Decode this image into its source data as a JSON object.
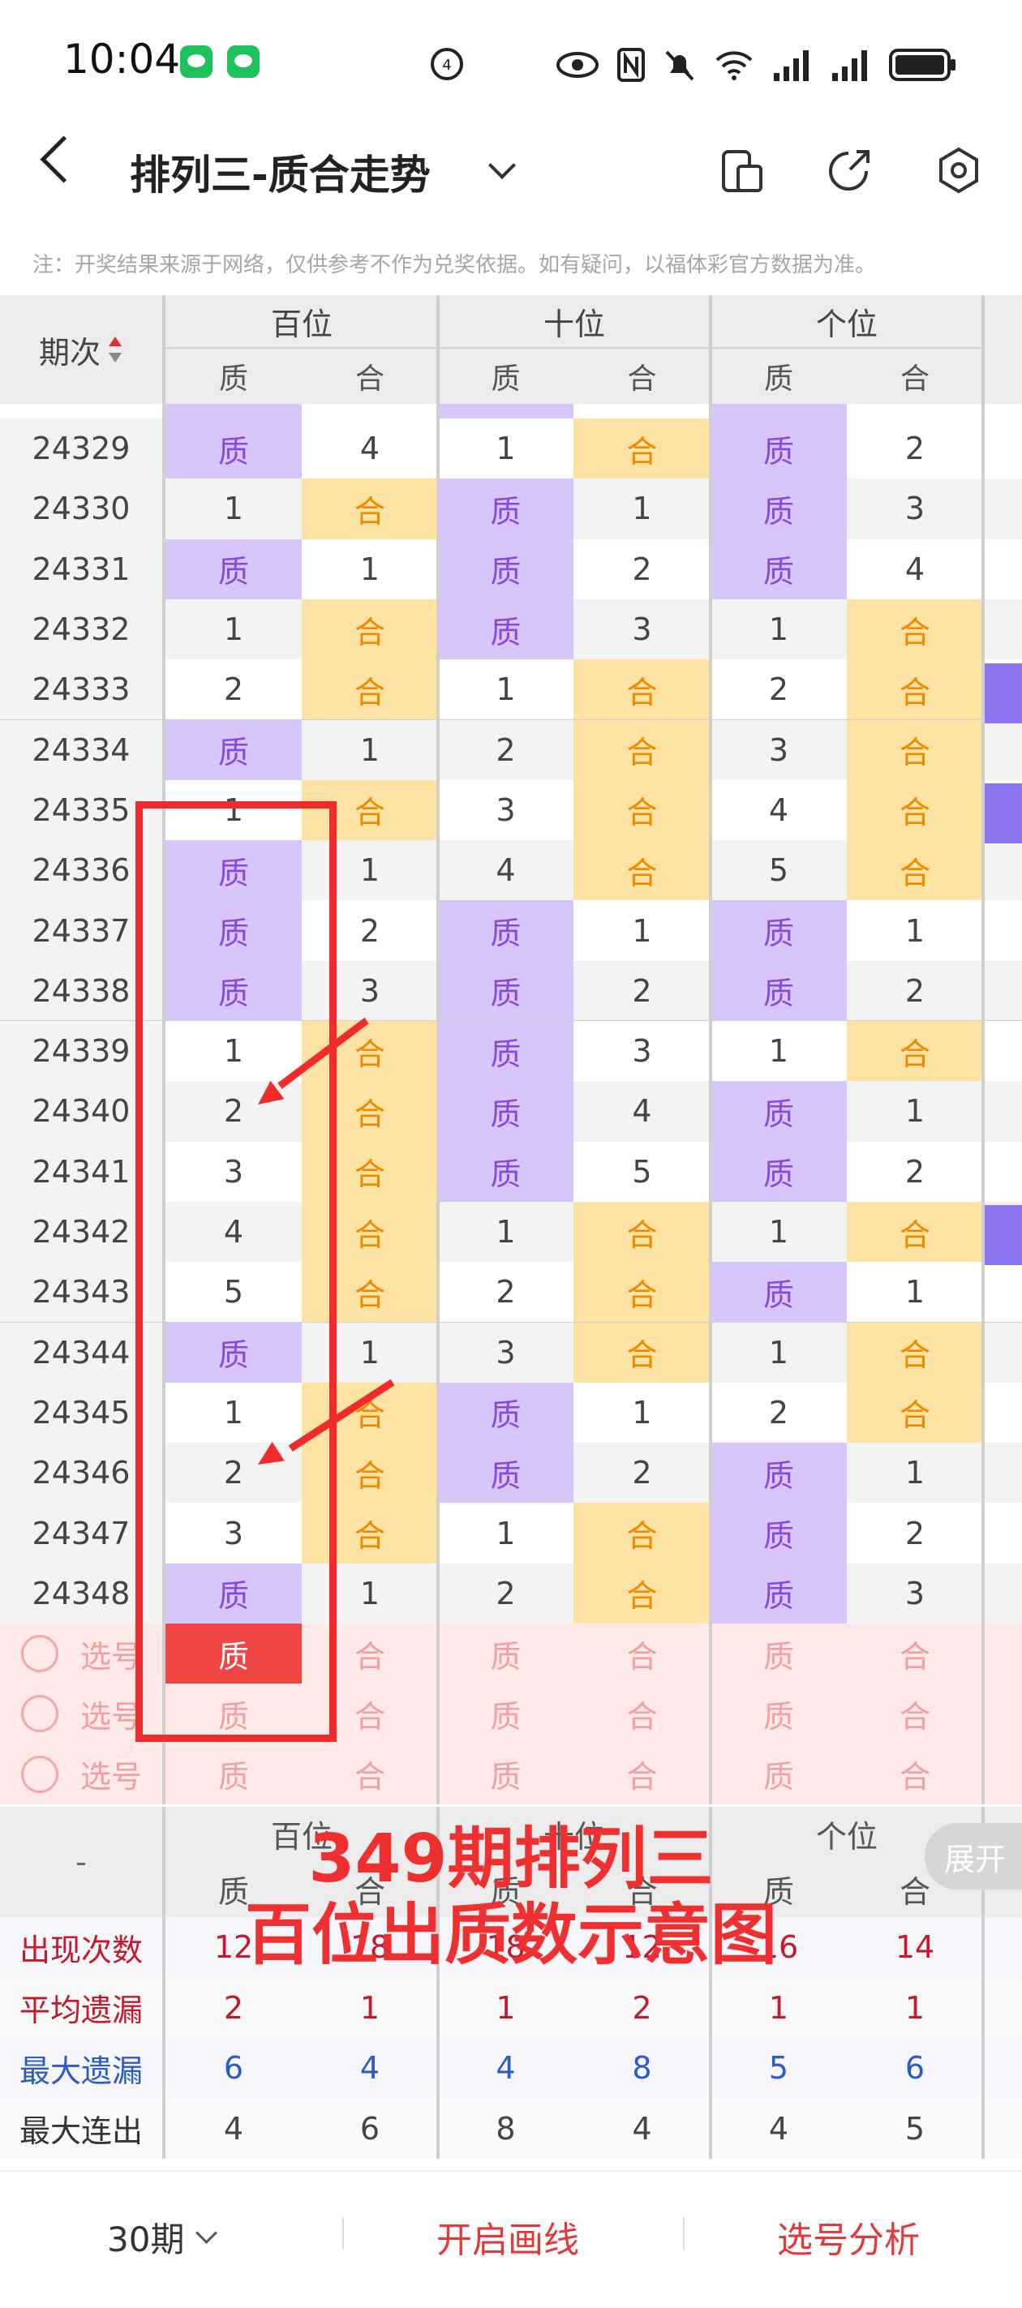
{
  "status_bar": {
    "time": "10:04"
  },
  "header": {
    "title": "排列三-质合走势"
  },
  "notice": "注：开奖结果来源于网络，仅供参考不作为兑奖依据。如有疑问，以福体彩官方数据为准。",
  "table": {
    "period_header": "期次",
    "groups": [
      "百位",
      "十位",
      "个位"
    ],
    "subheaders": [
      "质",
      "合",
      "质",
      "合",
      "质",
      "合"
    ],
    "rows": [
      {
        "period": "24329",
        "cells": [
          "质",
          "4",
          "1",
          "合",
          "质",
          "2"
        ]
      },
      {
        "period": "24330",
        "cells": [
          "1",
          "合",
          "质",
          "1",
          "质",
          "3"
        ]
      },
      {
        "period": "24331",
        "cells": [
          "质",
          "1",
          "质",
          "2",
          "质",
          "4"
        ]
      },
      {
        "period": "24332",
        "cells": [
          "1",
          "合",
          "质",
          "3",
          "1",
          "合"
        ]
      },
      {
        "period": "24333",
        "cells": [
          "2",
          "合",
          "1",
          "合",
          "2",
          "合"
        ]
      },
      {
        "period": "24334",
        "cells": [
          "质",
          "1",
          "2",
          "合",
          "3",
          "合"
        ]
      },
      {
        "period": "24335",
        "cells": [
          "1",
          "合",
          "3",
          "合",
          "4",
          "合"
        ]
      },
      {
        "period": "24336",
        "cells": [
          "质",
          "1",
          "4",
          "合",
          "5",
          "合"
        ]
      },
      {
        "period": "24337",
        "cells": [
          "质",
          "2",
          "质",
          "1",
          "质",
          "1"
        ]
      },
      {
        "period": "24338",
        "cells": [
          "质",
          "3",
          "质",
          "2",
          "质",
          "2"
        ]
      },
      {
        "period": "24339",
        "cells": [
          "1",
          "合",
          "质",
          "3",
          "1",
          "合"
        ]
      },
      {
        "period": "24340",
        "cells": [
          "2",
          "合",
          "质",
          "4",
          "质",
          "1"
        ]
      },
      {
        "period": "24341",
        "cells": [
          "3",
          "合",
          "质",
          "5",
          "质",
          "2"
        ]
      },
      {
        "period": "24342",
        "cells": [
          "4",
          "合",
          "1",
          "合",
          "1",
          "合"
        ]
      },
      {
        "period": "24343",
        "cells": [
          "5",
          "合",
          "2",
          "合",
          "质",
          "1"
        ]
      },
      {
        "period": "24344",
        "cells": [
          "质",
          "1",
          "3",
          "合",
          "1",
          "合"
        ]
      },
      {
        "period": "24345",
        "cells": [
          "1",
          "合",
          "质",
          "1",
          "2",
          "合"
        ]
      },
      {
        "period": "24346",
        "cells": [
          "2",
          "合",
          "质",
          "2",
          "质",
          "1"
        ]
      },
      {
        "period": "24347",
        "cells": [
          "3",
          "合",
          "1",
          "合",
          "质",
          "2"
        ]
      },
      {
        "period": "24348",
        "cells": [
          "质",
          "1",
          "2",
          "合",
          "质",
          "3"
        ]
      }
    ],
    "select_rows": [
      {
        "label": "选号",
        "cells": [
          "质",
          "合",
          "质",
          "合",
          "质",
          "合"
        ],
        "selected_index": 0
      },
      {
        "label": "选号",
        "cells": [
          "质",
          "合",
          "质",
          "合",
          "质",
          "合"
        ],
        "selected_index": -1
      },
      {
        "label": "选号",
        "cells": [
          "质",
          "合",
          "质",
          "合",
          "质",
          "合"
        ],
        "selected_index": -1
      }
    ]
  },
  "stats": {
    "dash": "-",
    "groups": [
      "百位",
      "十位",
      "个位"
    ],
    "subheaders": [
      "质",
      "合",
      "质",
      "合",
      "质",
      "合"
    ],
    "rows": [
      {
        "label": "出现次数",
        "values": [
          "12",
          "18",
          "18",
          "12",
          "16",
          "14"
        ],
        "color": "#c4182c"
      },
      {
        "label": "平均遗漏",
        "values": [
          "2",
          "1",
          "1",
          "2",
          "1",
          "1"
        ],
        "color": "#c4182c"
      },
      {
        "label": "最大遗漏",
        "values": [
          "6",
          "4",
          "4",
          "8",
          "5",
          "6"
        ],
        "color": "#2a5cc2"
      },
      {
        "label": "最大连出",
        "values": [
          "4",
          "6",
          "8",
          "4",
          "4",
          "5"
        ],
        "color": "#333333"
      }
    ],
    "expand_label": "展开"
  },
  "annotation": {
    "line1": "349期排列三",
    "line2": "百位出质数示意图"
  },
  "bottom_bar": {
    "periods_label": "30期",
    "draw_line_label": "开启画线",
    "analysis_label": "选号分析"
  },
  "colors": {
    "prime_bg": "#d8c5fa",
    "composite_bg": "#fde3a3",
    "accent_red": "#ef2b2b"
  }
}
